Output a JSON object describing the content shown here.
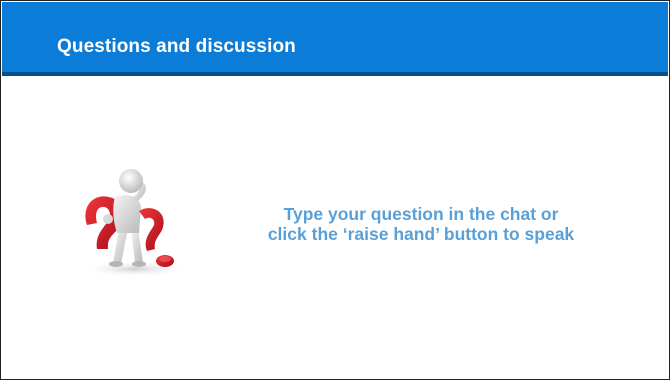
{
  "slide": {
    "title": "Questions and discussion",
    "caption_line1": "Type your question in the chat or",
    "caption_line2": "click the ‘raise hand’ button to speak"
  },
  "image": {
    "icon": "person-with-question-mark-icon",
    "colors": {
      "figure": "#d9d9d9",
      "question_mark": "#d8202a"
    }
  },
  "colors": {
    "title_bar": "#0b7dd9",
    "title_bar_shadow": "#064f8c",
    "title_text": "#ffffff",
    "caption_text": "#5aa0d8"
  }
}
